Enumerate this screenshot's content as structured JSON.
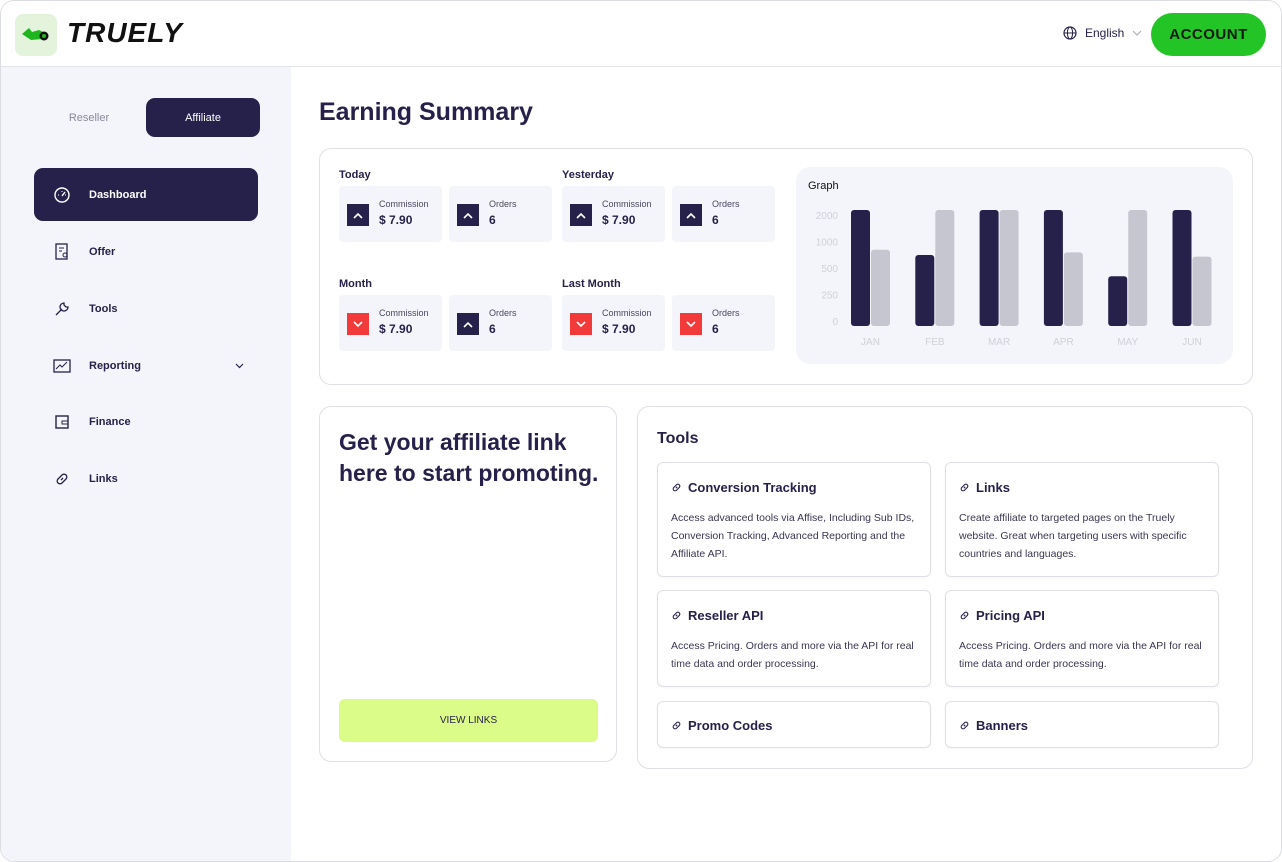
{
  "header": {
    "logo_text": "TRUELY",
    "language": "English",
    "account_label": "ACCOUNT"
  },
  "sidebar": {
    "segments": [
      {
        "label": "Reseller",
        "active": false
      },
      {
        "label": "Affiliate",
        "active": true
      }
    ],
    "items": [
      {
        "label": "Dashboard",
        "icon": "dashboard-gauge-icon",
        "active": true
      },
      {
        "label": "Offer",
        "icon": "offer-document-icon"
      },
      {
        "label": "Tools",
        "icon": "wrench-icon"
      },
      {
        "label": "Reporting",
        "icon": "chart-line-icon",
        "has_dropdown": true
      },
      {
        "label": "Finance",
        "icon": "wallet-icon"
      },
      {
        "label": "Links",
        "icon": "link-icon"
      }
    ]
  },
  "main": {
    "title": "Earning Summary",
    "periods": [
      {
        "label": "Today",
        "commission_label": "Commission",
        "commission": "$ 7.90",
        "commission_trend": "up",
        "orders_label": "Orders",
        "orders": "6",
        "orders_trend": "up"
      },
      {
        "label": "Yesterday",
        "commission_label": "Commission",
        "commission": "$ 7.90",
        "commission_trend": "up",
        "orders_label": "Orders",
        "orders": "6",
        "orders_trend": "up"
      },
      {
        "label": "Month",
        "commission_label": "Commission",
        "commission": "$ 7.90",
        "commission_trend": "down",
        "orders_label": "Orders",
        "orders": "6",
        "orders_trend": "up"
      },
      {
        "label": "Last Month",
        "commission_label": "Commission",
        "commission": "$ 7.90",
        "commission_trend": "down",
        "orders_label": "Orders",
        "orders": "6",
        "orders_trend": "down"
      }
    ],
    "colors": {
      "up": "#26214a",
      "down": "#f23a3a",
      "accent": "#23c426",
      "cta": "#dcfc8a"
    },
    "affiliate": {
      "title": "Get your affiliate link here to start promoting.",
      "button": "VIEW LINKS"
    },
    "tools": {
      "title": "Tools",
      "items": [
        {
          "title": "Conversion Tracking",
          "desc": "Access advanced tools via Affise, Including Sub IDs, Conversion Tracking, Advanced Reporting and the Affiliate API."
        },
        {
          "title": "Links",
          "desc": "Create affiliate to targeted pages on the Truely website. Great when targeting users with specific countries and languages."
        },
        {
          "title": "Reseller API",
          "desc": "Access Pricing. Orders and more via the API for real time data and order processing."
        },
        {
          "title": "Pricing API",
          "desc": "Access Pricing. Orders and more via the API for real time data and order processing."
        },
        {
          "title": "Promo Codes",
          "desc": ""
        },
        {
          "title": "Banners",
          "desc": ""
        }
      ]
    }
  },
  "chart_data": {
    "type": "bar",
    "title": "Graph",
    "categories": [
      "JAN",
      "FEB",
      "MAR",
      "APR",
      "MAY",
      "JUN"
    ],
    "y_ticks": [
      0,
      250,
      500,
      1000,
      2000
    ],
    "series": [
      {
        "values": [
          2000,
          650,
          2000,
          2000,
          375,
          2000
        ],
        "color": "#26214a"
      },
      {
        "values": [
          750,
          2000,
          2000,
          700,
          2000,
          620
        ],
        "color": "#c6c6d0"
      }
    ],
    "grid": false
  }
}
